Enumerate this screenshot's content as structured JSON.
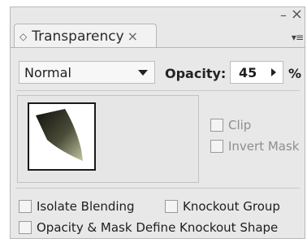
{
  "window": {
    "minimize_glyph": "–",
    "close_glyph": "×"
  },
  "panel": {
    "tab_label": "Transparency",
    "tab_close_glyph": "×",
    "tab_grip_glyph": "◇",
    "menu_glyph": "▾≡"
  },
  "blend_mode": {
    "selected": "Normal",
    "options_visible": [
      "Normal"
    ]
  },
  "opacity": {
    "label": "Opacity:",
    "value": "45",
    "unit": "%"
  },
  "mask": {
    "clip_label": "Clip",
    "clip_checked": false,
    "invert_mask_label": "Invert Mask",
    "invert_mask_checked": false
  },
  "options": {
    "isolate_blending_label": "Isolate Blending",
    "isolate_blending_checked": false,
    "knockout_group_label": "Knockout Group",
    "knockout_group_checked": false,
    "opacity_mask_knockout_label": "Opacity & Mask Define Knockout Shape",
    "opacity_mask_knockout_checked": false
  },
  "colors": {
    "panel_bg": "#e8e8e8",
    "thumbnail_shape_dark": "#0f0f0b",
    "thumbnail_shape_light": "#c2c6a2"
  }
}
